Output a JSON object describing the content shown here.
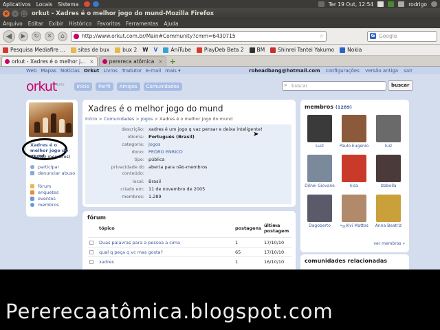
{
  "ubuntu_panel": {
    "menus": [
      "Aplicativos",
      "Locais",
      "Sistema"
    ],
    "clock": "Ter 19 Out, 12:54",
    "user": "rodrigo"
  },
  "window": {
    "title": "orkut - Xadres é o melhor jogo do mund-Mozilla Firefox"
  },
  "menubar": [
    "Arquivo",
    "Editar",
    "Exibir",
    "Histórico",
    "Favoritos",
    "Ferramentas",
    "Ajuda"
  ],
  "navbar": {
    "url": "http://www.orkut.com.br/Main#Community?cmm=6430715",
    "search_placeholder": "Google"
  },
  "bookmarks": [
    {
      "label": "Pesquisa Mediafire ...",
      "color": "#d43a2c"
    },
    {
      "label": "sites de bux",
      "color": "#e8b84a"
    },
    {
      "label": "bux 2",
      "color": "#e8b84a"
    },
    {
      "label": "W",
      "color": "#666666"
    },
    {
      "label": "V",
      "color": "#2a62c9"
    },
    {
      "label": "AniTube",
      "color": "#3aa0d8"
    },
    {
      "label": "PlayDeb Beta 2",
      "color": "#d43a2c"
    },
    {
      "label": "BM",
      "color": "#333333"
    },
    {
      "label": "Shinrei Tantei Yakumo",
      "color": "#c9302c"
    },
    {
      "label": "Nokia",
      "color": "#2a62c9"
    }
  ],
  "tabs": [
    {
      "label": "orkut - Xadres é o melhor j...",
      "active": true
    },
    {
      "label": "perereca atômica",
      "active": false
    }
  ],
  "orkut": {
    "toplinks": [
      "Web",
      "Mapas",
      "Notícias",
      "Orkut",
      "Livros",
      "Tradutor",
      "E-mail",
      "mais ▾"
    ],
    "email": "roheadbang@hotmail.com",
    "account_links": [
      "configurações",
      "versão antiga",
      "sair"
    ],
    "logo": "orkut",
    "logo_beta": "beta",
    "nav_buttons": [
      "Início",
      "Perfil",
      "Amigos",
      "Comunidades"
    ],
    "search_placeholder": "buscar",
    "search_button": "buscar"
  },
  "community": {
    "name_short": "Xadres é o melhor jogo do mund",
    "member_count": "(1.289 membros)",
    "title": "Xadres é o melhor jogo do mund",
    "breadcrumb": [
      "Início",
      "Comunidades",
      "Jogos",
      "Xadres é o melhor jogo do mund"
    ],
    "actions": [
      "participar",
      "denunciar abuso"
    ],
    "sections": [
      "fórum",
      "enquetes",
      "eventos",
      "membros"
    ],
    "info": [
      {
        "k": "descrição:",
        "v": "xadres é um jogo q vaz pensar e deixa inteligente!",
        "style": ""
      },
      {
        "k": "idioma:",
        "v": "Português (Brasil)",
        "style": "bold"
      },
      {
        "k": "categoria:",
        "v": "Jogos",
        "style": "link"
      },
      {
        "k": "dono:",
        "v": "PEDRO ENRICO",
        "style": "link"
      },
      {
        "k": "tipo:",
        "v": "pública",
        "style": ""
      },
      {
        "k": "privacidade do",
        "v": "aberta para não-membros",
        "style": ""
      },
      {
        "k": "conteúdo:",
        "v": "",
        "style": ""
      },
      {
        "k": "local:",
        "v": "Brasil",
        "style": ""
      },
      {
        "k": "criado em:",
        "v": "11 de novembro de 2005",
        "style": ""
      },
      {
        "k": "membros:",
        "v": "1.289",
        "style": ""
      }
    ]
  },
  "forum": {
    "title": "fórum",
    "headers": {
      "topic": "tópico",
      "posts": "postagens",
      "last1": "última",
      "last2": "postagem"
    },
    "rows": [
      {
        "topic": "Duas palavras para a pessoa a cima",
        "posts": "1",
        "date": "17/10/10"
      },
      {
        "topic": "qual q peça q vc mas gosta?",
        "posts": "65",
        "date": "17/10/10"
      },
      {
        "topic": "xadres",
        "posts": "1",
        "date": "16/10/10"
      }
    ]
  },
  "members": {
    "title": "membros",
    "count": "(1289)",
    "list": [
      {
        "name": "Luiz",
        "color": "#3a3a3a"
      },
      {
        "name": "Paulo Eugenio",
        "color": "#8a5a3a"
      },
      {
        "name": "luiz",
        "color": "#6a6a6a"
      },
      {
        "name": "Dilnei Giovane",
        "color": "#7a8a9a"
      },
      {
        "name": "kisa",
        "color": "#c93a2a"
      },
      {
        "name": "Izabella",
        "color": "#4a3a3a"
      },
      {
        "name": "Dagoberto",
        "color": "#5a5a6a"
      },
      {
        "name": "•ஐVivi Mattos",
        "color": "#b08a6a"
      },
      {
        "name": "Anna Beatriz",
        "color": "#c9a03a"
      }
    ],
    "see_all": "ver membros »"
  },
  "related": {
    "title": "comunidades relacionadas"
  },
  "watermark": "Pererecaatômica.blogspot.com"
}
